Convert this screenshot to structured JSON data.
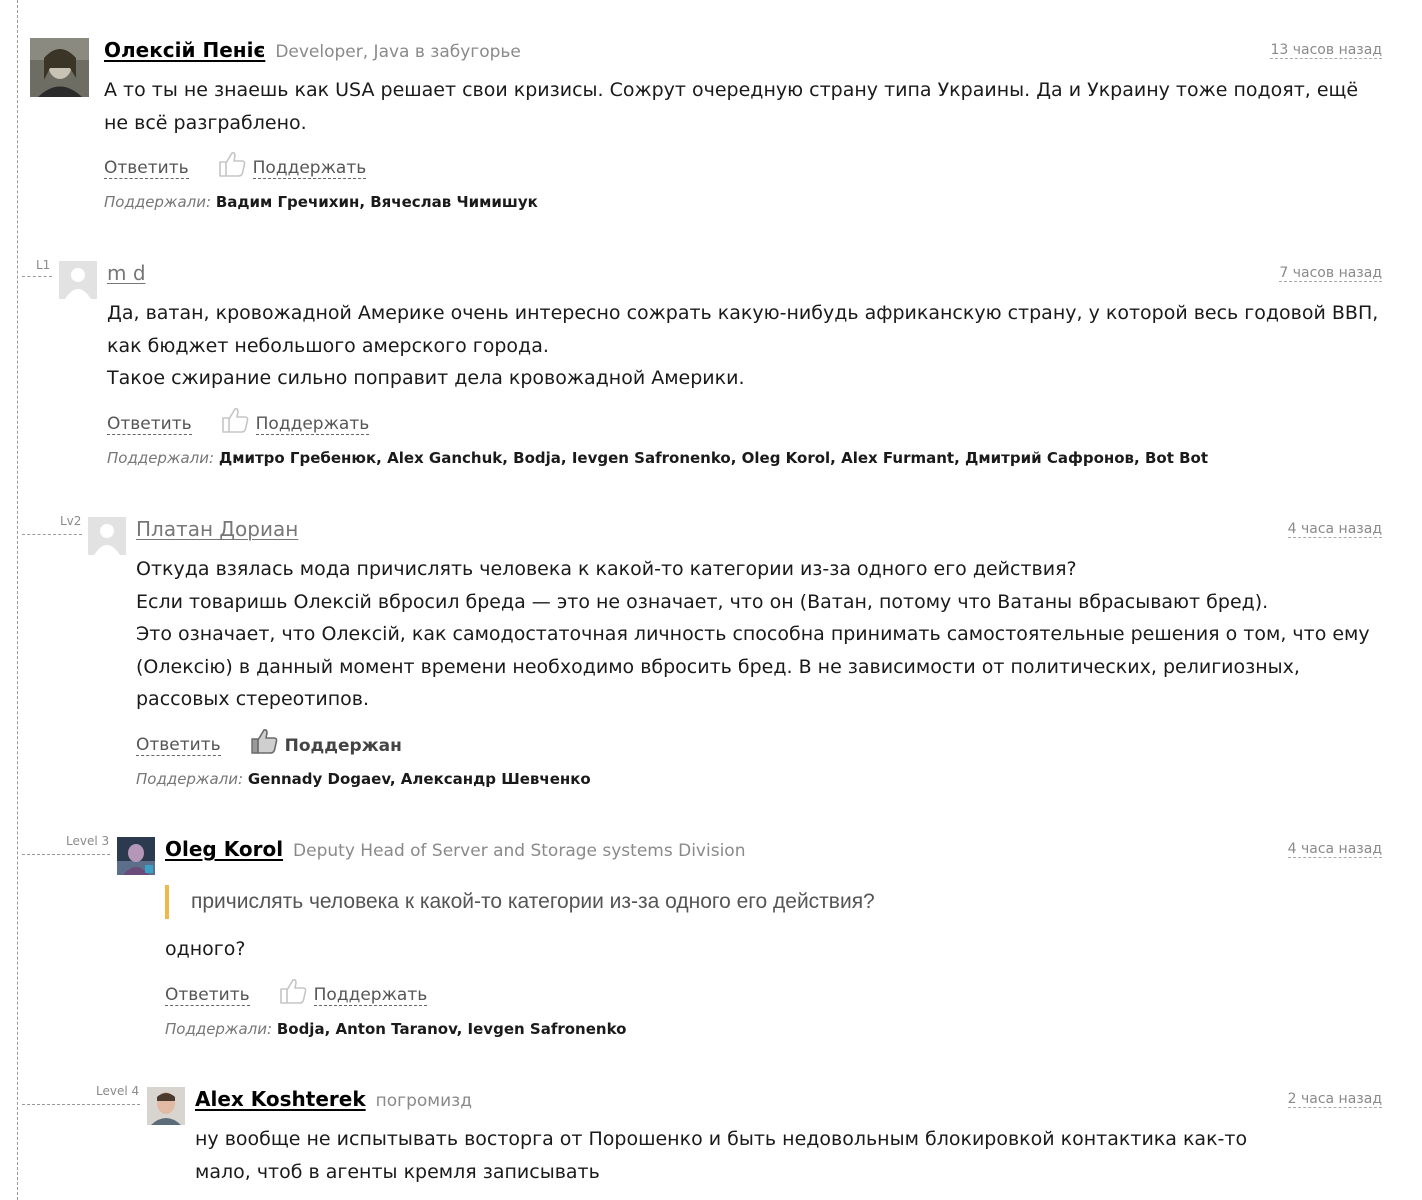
{
  "comments": [
    {
      "author": "Олексій Пеніє",
      "subtitle": "Developer, Java в забугорье",
      "time": "13 часов назад",
      "text": [
        "А то ты не знаешь как USA решает свои кризисы. Сожрут очередную страну типа Украины. Да и Украину тоже подоят, ещё не всё разграблено."
      ],
      "reply_label": "Ответить",
      "like_label": "Поддержать",
      "supporters_label": "Поддержали:",
      "supporters": "Вадим Гречихин, Вячеслав Чимишук"
    },
    {
      "level_label": "L1",
      "author": "m d",
      "time": "7 часов назад",
      "text": [
        "Да, ватан, кровожадной Америке очень интересно сожрать какую-нибудь африканскую страну, у которой весь годовой ВВП, как бюджет небольшого амерского города.",
        "Такое сжирание сильно поправит дела кровожадной Америки."
      ],
      "reply_label": "Ответить",
      "like_label": "Поддержать",
      "supporters_label": "Поддержали:",
      "supporters": "Дмитро Гребенюк, Alex Ganchuk, Bodja, Ievgen Safronenko, Oleg Korol, Alex Furmant, Дмитрий Сафронов, Bot Bot"
    },
    {
      "level_label": "Lv2",
      "author": "Платан Дориан",
      "time": "4 часа назад",
      "text": [
        "Откуда взялась мода причислять человека к какой-то категории из-за одного его действия?",
        "Если товаришь Олексій вбросил бреда — это не означает, что он (Ватан, потому что Ватаны вбрасывают бред).",
        "Это означает, что Олексій, как самодостаточная личность способна принимать самостоятельные решения о том, что ему (Олексію) в данный момент времени необходимо вбросить бред. В не зависимости от политических, религиозных, рассовых стереотипов."
      ],
      "reply_label": "Ответить",
      "like_label": "Поддержан",
      "supporters_label": "Поддержали:",
      "supporters": "Gennady Dogaev, Александр Шевченко"
    },
    {
      "level_label": "Level 3",
      "author": "Oleg Korol",
      "subtitle": "Deputy Head of Server and Storage systems Division",
      "time": "4 часа назад",
      "quote": "причислять человека к какой-то категории из-за одного его действия?",
      "text": [
        "одного?"
      ],
      "reply_label": "Ответить",
      "like_label": "Поддержать",
      "supporters_label": "Поддержали:",
      "supporters": "Bodja, Anton Taranov, Ievgen Safronenko"
    },
    {
      "level_label": "Level 4",
      "author": "Alex Koshterek",
      "subtitle": "погромизд",
      "time": "2 часа назад",
      "text": [
        "ну вообще не испытывать восторга от Порошенко и быть недовольным блокировкой контактика как-то мало, чтоб в агенты кремля записывать"
      ]
    }
  ]
}
